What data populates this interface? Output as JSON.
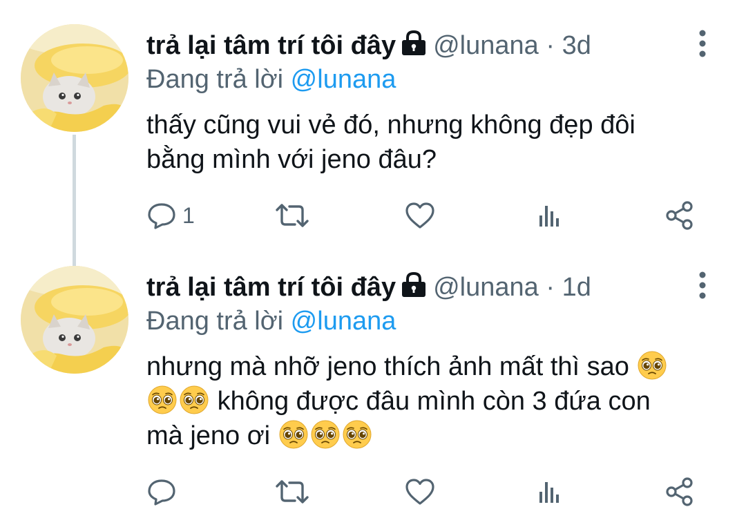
{
  "tweets": [
    {
      "display_name": "trả lại tâm trí tôi đây",
      "handle": "@lunana",
      "separator": "·",
      "time": "3d",
      "reply_prefix": "Đang trả lời",
      "reply_to": "@lunana",
      "text_lines": [
        "thấy cũng vui vẻ đó, nhưng không đẹp đôi",
        "bằng mình với jeno đâu?"
      ],
      "reply_count": "1",
      "icons": [
        "lock-icon",
        "more-icon",
        "reply-icon",
        "retweet-icon",
        "like-icon",
        "analytics-icon",
        "share-icon"
      ]
    },
    {
      "display_name": "trả lại tâm trí tôi đây",
      "handle": "@lunana",
      "separator": "·",
      "time": "1d",
      "reply_prefix": "Đang trả lời",
      "reply_to": "@lunana",
      "text_lines": [
        "nhưng mà nhỡ jeno thích ảnh mất thì sao",
        "không được đâu mình còn 3 đứa con",
        "mà jeno ơi"
      ],
      "reply_count": "",
      "icons": [
        "lock-icon",
        "more-icon",
        "reply-icon",
        "retweet-icon",
        "like-icon",
        "analytics-icon",
        "share-icon"
      ]
    }
  ],
  "emoji_name": "pleading-face-emoji",
  "colors": {
    "text": "#0f1419",
    "secondary": "#536471",
    "mention": "#1d9bf0",
    "thread_line": "#cfd9de"
  }
}
